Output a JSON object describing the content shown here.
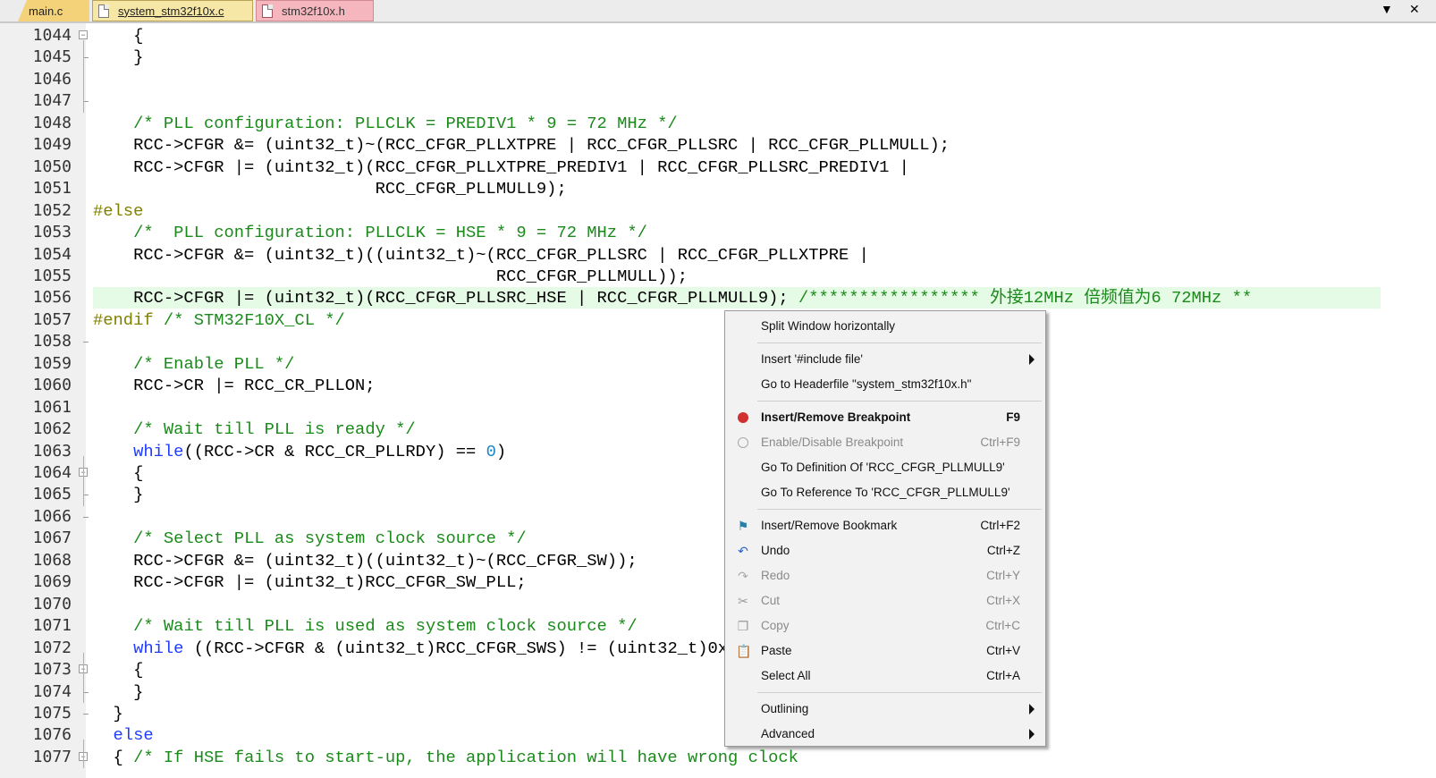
{
  "tabs": [
    {
      "label": "main.c"
    },
    {
      "label": "system_stm32f10x.c"
    },
    {
      "label": "stm32f10x.h"
    }
  ],
  "tab_controls": {
    "dropdown": "▼",
    "close": "✕"
  },
  "code_lines": [
    {
      "n": "1044",
      "html": "    {"
    },
    {
      "n": "1045",
      "html": "    }"
    },
    {
      "n": "1046",
      "html": ""
    },
    {
      "n": "1047",
      "html": ""
    },
    {
      "n": "1048",
      "html": "    <span class=\"cm\">/* PLL configuration: PLLCLK = PREDIV1 * 9 = 72 MHz */</span>"
    },
    {
      "n": "1049",
      "html": "    RCC->CFGR &amp;= (uint32_t)~(RCC_CFGR_PLLXTPRE | RCC_CFGR_PLLSRC | RCC_CFGR_PLLMULL);"
    },
    {
      "n": "1050",
      "html": "    RCC->CFGR |= (uint32_t)(RCC_CFGR_PLLXTPRE_PREDIV1 | RCC_CFGR_PLLSRC_PREDIV1 |"
    },
    {
      "n": "1051",
      "html": "                            RCC_CFGR_PLLMULL9);"
    },
    {
      "n": "1052",
      "html": "<span class=\"pp\">#else</span>"
    },
    {
      "n": "1053",
      "html": "    <span class=\"cm\">/*  PLL configuration: PLLCLK = HSE * 9 = 72 MHz */</span>"
    },
    {
      "n": "1054",
      "html": "    RCC->CFGR &amp;= (uint32_t)((uint32_t)~(RCC_CFGR_PLLSRC | RCC_CFGR_PLLXTPRE |"
    },
    {
      "n": "1055",
      "html": "                                        RCC_CFGR_PLLMULL));"
    },
    {
      "n": "1056",
      "html": "    RCC->CFGR |= (uint32_t)(RCC_CFGR_PLLSRC_HSE | RCC_CFGR_PLLMULL9); <span class=\"cm\">/***************** 外接12MHz 倍频值为6 72MHz **</span>"
    },
    {
      "n": "1057",
      "html": "<span class=\"pp\">#endif</span> <span class=\"cm\">/* STM32F10X_CL */</span>"
    },
    {
      "n": "1058",
      "html": ""
    },
    {
      "n": "1059",
      "html": "    <span class=\"cm\">/* Enable PLL */</span>"
    },
    {
      "n": "1060",
      "html": "    RCC->CR |= RCC_CR_PLLON;"
    },
    {
      "n": "1061",
      "html": ""
    },
    {
      "n": "1062",
      "html": "    <span class=\"cm\">/* Wait till PLL is ready */</span>"
    },
    {
      "n": "1063",
      "html": "    <span class=\"kw\">while</span>((RCC->CR &amp; RCC_CR_PLLRDY) == <span class=\"num\">0</span>)"
    },
    {
      "n": "1064",
      "html": "    {"
    },
    {
      "n": "1065",
      "html": "    }"
    },
    {
      "n": "1066",
      "html": ""
    },
    {
      "n": "1067",
      "html": "    <span class=\"cm\">/* Select PLL as system clock source */</span>"
    },
    {
      "n": "1068",
      "html": "    RCC->CFGR &amp;= (uint32_t)((uint32_t)~(RCC_CFGR_SW));"
    },
    {
      "n": "1069",
      "html": "    RCC->CFGR |= (uint32_t)RCC_CFGR_SW_PLL;"
    },
    {
      "n": "1070",
      "html": ""
    },
    {
      "n": "1071",
      "html": "    <span class=\"cm\">/* Wait till PLL is used as system clock source */</span>"
    },
    {
      "n": "1072",
      "html": "    <span class=\"kw\">while</span> ((RCC->CFGR &amp; (uint32_t)RCC_CFGR_SWS) != (uint32_t)0x08)"
    },
    {
      "n": "1073",
      "html": "    {"
    },
    {
      "n": "1074",
      "html": "    }"
    },
    {
      "n": "1075",
      "html": "  }"
    },
    {
      "n": "1076",
      "html": "  <span class=\"kw\">else</span>"
    },
    {
      "n": "1077",
      "html": "  { <span class=\"cm\">/* If HSE fails to start-up, the application will have wrong clock</span>"
    }
  ],
  "context_menu": [
    {
      "label": "Split Window horizontally",
      "shortcut": "",
      "icon": "",
      "state": "normal",
      "submenu": false,
      "sep_after": true
    },
    {
      "label": "Insert '#include file'",
      "shortcut": "",
      "icon": "",
      "state": "normal",
      "submenu": true,
      "sep_after": false
    },
    {
      "label": "Go to Headerfile \"system_stm32f10x.h\"",
      "shortcut": "",
      "icon": "",
      "state": "normal",
      "submenu": false,
      "sep_after": true
    },
    {
      "label": "Insert/Remove Breakpoint",
      "shortcut": "F9",
      "icon": "breakpoint-icon",
      "state": "bold",
      "submenu": false,
      "sep_after": false
    },
    {
      "label": "Enable/Disable Breakpoint",
      "shortcut": "Ctrl+F9",
      "icon": "breakpoint-outline-icon",
      "state": "disabled",
      "submenu": false,
      "sep_after": false
    },
    {
      "label": "Go To Definition Of 'RCC_CFGR_PLLMULL9'",
      "shortcut": "",
      "icon": "",
      "state": "normal",
      "submenu": false,
      "sep_after": false
    },
    {
      "label": "Go To Reference To 'RCC_CFGR_PLLMULL9'",
      "shortcut": "",
      "icon": "",
      "state": "normal",
      "submenu": false,
      "sep_after": true
    },
    {
      "label": "Insert/Remove Bookmark",
      "shortcut": "Ctrl+F2",
      "icon": "bookmark-icon",
      "state": "normal",
      "submenu": false,
      "sep_after": false
    },
    {
      "label": "Undo",
      "shortcut": "Ctrl+Z",
      "icon": "undo-icon",
      "state": "normal",
      "submenu": false,
      "sep_after": false
    },
    {
      "label": "Redo",
      "shortcut": "Ctrl+Y",
      "icon": "redo-icon",
      "state": "disabled",
      "submenu": false,
      "sep_after": false
    },
    {
      "label": "Cut",
      "shortcut": "Ctrl+X",
      "icon": "cut-icon",
      "state": "disabled",
      "submenu": false,
      "sep_after": false
    },
    {
      "label": "Copy",
      "shortcut": "Ctrl+C",
      "icon": "copy-icon",
      "state": "disabled",
      "submenu": false,
      "sep_after": false
    },
    {
      "label": "Paste",
      "shortcut": "Ctrl+V",
      "icon": "paste-icon",
      "state": "normal",
      "submenu": false,
      "sep_after": false
    },
    {
      "label": "Select All",
      "shortcut": "Ctrl+A",
      "icon": "",
      "state": "normal",
      "submenu": false,
      "sep_after": true
    },
    {
      "label": "Outlining",
      "shortcut": "",
      "icon": "",
      "state": "normal",
      "submenu": true,
      "sep_after": false
    },
    {
      "label": "Advanced",
      "shortcut": "",
      "icon": "",
      "state": "normal",
      "submenu": true,
      "sep_after": false
    }
  ],
  "colors": {
    "comment": "#1a8a1a",
    "keyword": "#1f3cff",
    "preprocessor": "#808000",
    "highlight_line": "#e6fbe6"
  }
}
